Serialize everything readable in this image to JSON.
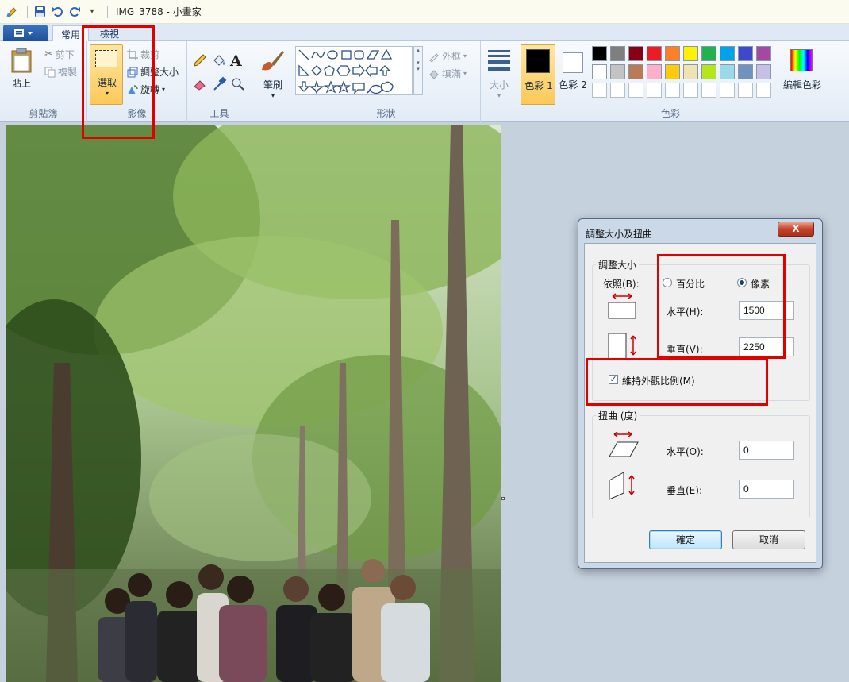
{
  "window": {
    "title": "IMG_3788 - 小畫家"
  },
  "tabs": [
    {
      "label": "常用"
    },
    {
      "label": "檢視"
    }
  ],
  "ribbon": {
    "clipboard": {
      "paste": "貼上",
      "cut": "剪下",
      "copy": "複製",
      "group": "剪貼簿"
    },
    "image": {
      "select": "選取",
      "crop": "裁剪",
      "resize": "調整大小",
      "rotate": "旋轉",
      "group": "影像"
    },
    "tools": {
      "group": "工具",
      "text_glyph": "A"
    },
    "brush": {
      "label": "筆刷"
    },
    "shapes": {
      "outline": "外框",
      "fill": "填滿",
      "group": "形狀"
    },
    "size": {
      "label": "大小"
    },
    "colors": {
      "color1": "色彩 1",
      "color2": "色彩 2",
      "edit": "編輯色彩",
      "group": "色彩",
      "palette_row1": [
        "#000000",
        "#7f7f7f",
        "#880015",
        "#ed1c24",
        "#ff7f27",
        "#fff200",
        "#22b14c",
        "#00a2e8",
        "#3f48cc",
        "#a349a4"
      ],
      "palette_row2": [
        "#ffffff",
        "#c3c3c3",
        "#b97a57",
        "#ffaec9",
        "#ffc90e",
        "#efe4b0",
        "#b5e61d",
        "#99d9ea",
        "#7092be",
        "#c8bfe7"
      ]
    }
  },
  "dialog": {
    "title": "調整大小及扭曲",
    "close": "X",
    "resize_legend": "調整大小",
    "by_label": "依照(B):",
    "percent_label": "百分比",
    "pixels_label": "像素",
    "horizontal_label": "水平(H):",
    "horizontal_value": "1500",
    "vertical_label": "垂直(V):",
    "vertical_value": "2250",
    "keep_ratio_label": "維持外觀比例(M)",
    "skew_legend": "扭曲 (度)",
    "skew_h_label": "水平(O):",
    "skew_h_value": "0",
    "skew_v_label": "垂直(E):",
    "skew_v_value": "0",
    "ok": "確定",
    "cancel": "取消"
  }
}
